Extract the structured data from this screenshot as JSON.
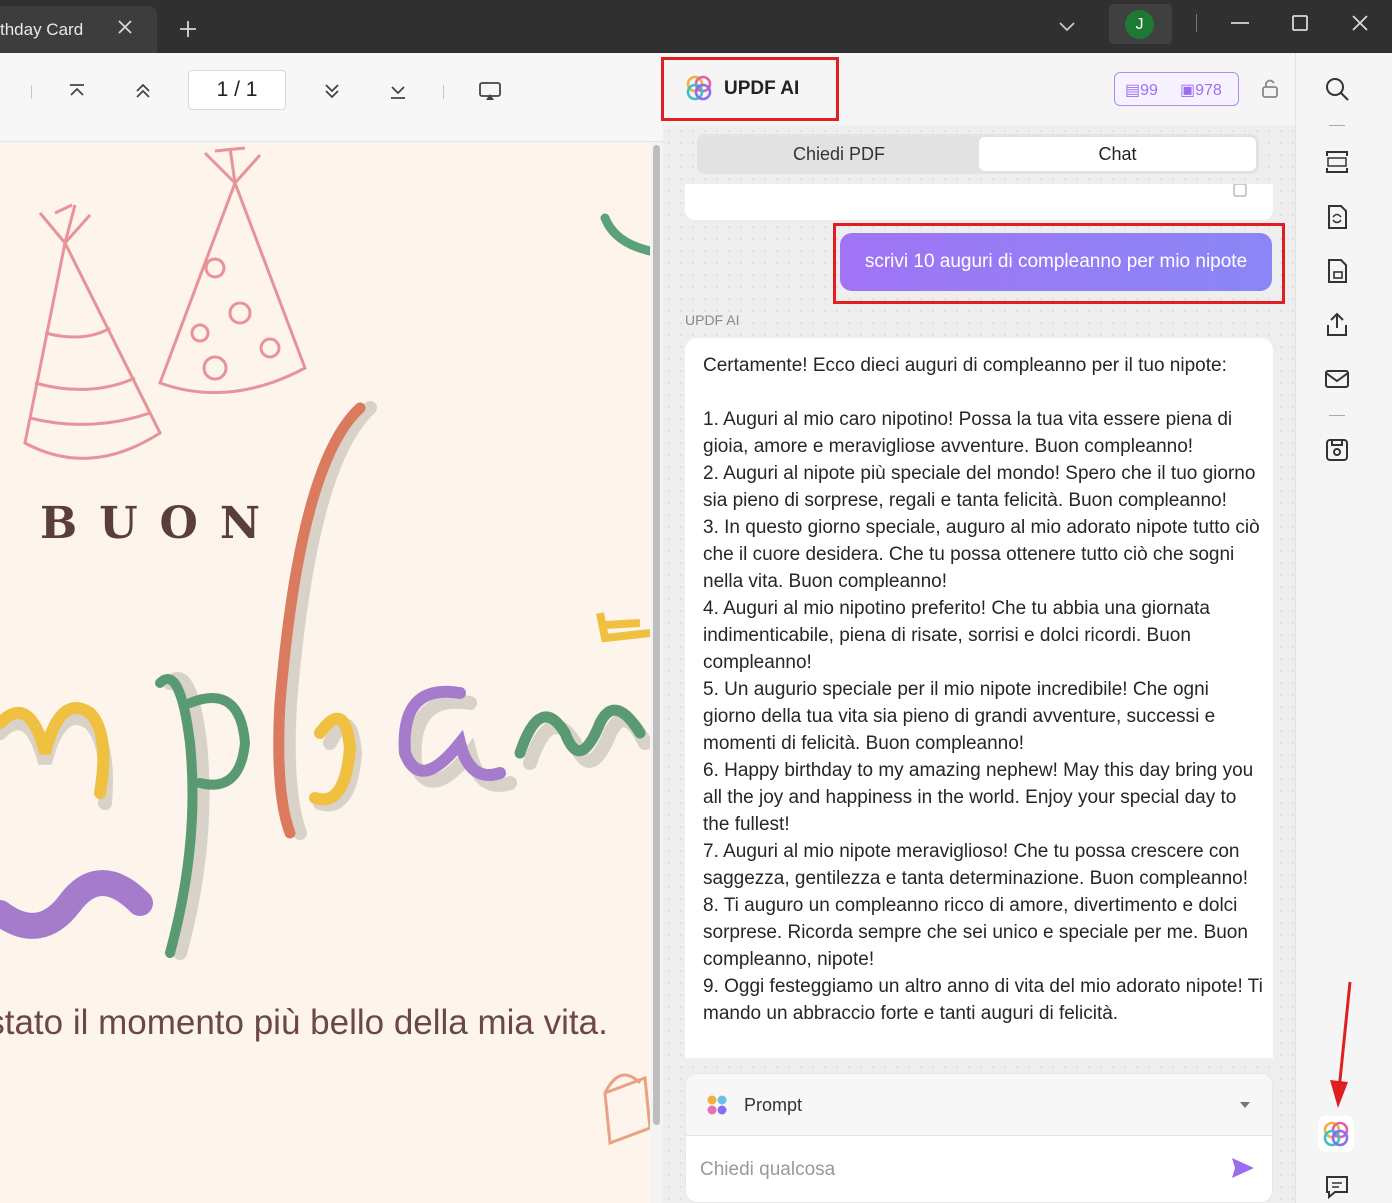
{
  "titlebar": {
    "tab_title": "thday Card",
    "avatar_initial": "J"
  },
  "viewer": {
    "page_indicator": "1 / 1",
    "card": {
      "buon": "BUON",
      "script_word": "mpleann",
      "text": "certi è stato il momento più bello della mia vita."
    }
  },
  "ai_panel": {
    "title": "UPDF AI",
    "quota_docs": "99",
    "quota_chats": "978",
    "tabs": [
      "Chiedi PDF",
      "Chat"
    ],
    "active_tab": "Chat",
    "user_message": "scrivi 10 auguri di compleanno per mio nipote",
    "ai_label": "UPDF AI",
    "ai_intro": "Certamente! Ecco dieci auguri di compleanno per il tuo nipote:",
    "ai_lines": [
      "1. Auguri al mio caro nipotino! Possa la tua vita essere piena di gioia, amore e meravigliose avventure. Buon compleanno!",
      "2. Auguri al nipote più speciale del mondo! Spero che il tuo giorno sia pieno di sorprese, regali e tanta felicità. Buon compleanno!",
      "3. In questo giorno speciale, auguro al mio adorato nipote tutto ciò che il cuore desidera. Che tu possa ottenere tutto ciò che sogni nella vita. Buon compleanno!",
      "4. Auguri al mio nipotino preferito! Che tu abbia una giornata indimenticabile, piena di risate, sorrisi e dolci ricordi. Buon compleanno!",
      "5. Un augurio speciale per il mio nipote incredibile! Che ogni giorno della tua vita sia pieno di grandi avventure, successi e momenti di felicità. Buon compleanno!",
      "6. Happy birthday to my amazing nephew! May this day bring you all the joy and happiness in the world. Enjoy your special day to the fullest!",
      "7. Auguri al mio nipote meraviglioso! Che tu possa crescere con saggezza, gentilezza e tanta determinazione. Buon compleanno!",
      "8. Ti auguro un compleanno ricco di amore, divertimento e dolci sorprese. Ricorda sempre che sei unico e speciale per me. Buon compleanno, nipote!",
      "9. Oggi festeggiamo un altro anno di vita del mio adorato nipote! Ti mando un abbraccio forte e tanti auguri di felicità."
    ],
    "prompt_label": "Prompt",
    "input_placeholder": "Chiedi qualcosa"
  },
  "colors": {
    "accent": "#9b6ef0",
    "highlight_box": "#e02020",
    "card_bg": "#fdf4ec"
  },
  "icons": {
    "titlebar": [
      "close-icon",
      "plus-icon",
      "chevron-down-icon",
      "minimize-icon",
      "maximize-icon",
      "close-icon"
    ],
    "viewer_toolbar": [
      "first-page-icon",
      "prev-page-icon",
      "next-page-icon",
      "last-page-icon",
      "presentation-icon"
    ],
    "sidebar": [
      "search-icon",
      "ocr-icon",
      "convert-icon",
      "protect-icon",
      "share-icon",
      "mail-icon",
      "save-icon",
      "updf-ai-icon",
      "comment-icon"
    ]
  }
}
